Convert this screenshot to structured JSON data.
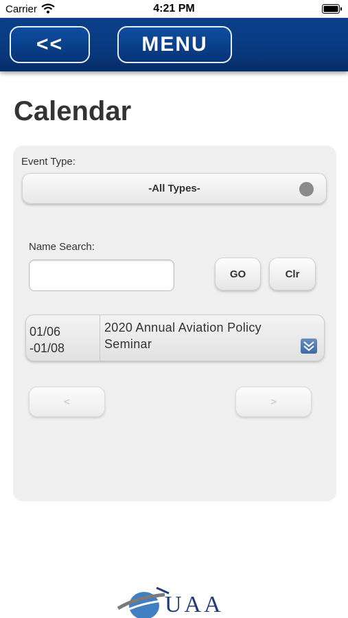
{
  "status_bar": {
    "carrier": "Carrier",
    "time": "4:21 PM"
  },
  "nav": {
    "back_label": "<<",
    "menu_label": "MENU"
  },
  "page": {
    "title": "Calendar"
  },
  "filters": {
    "event_type_label": "Event Type:",
    "event_type_value": "-All Types-",
    "name_search_label": "Name Search:",
    "name_search_value": "",
    "go_label": "GO",
    "clear_label": "Clr"
  },
  "events": [
    {
      "date_start": "01/06",
      "date_end": "-01/08",
      "title": "2020 Annual Aviation Policy Seminar"
    }
  ],
  "pager": {
    "prev_label": "<",
    "next_label": ">"
  },
  "footer": {
    "logo_text": "UAA"
  },
  "colors": {
    "nav_blue": "#0b3f8a",
    "panel_bg": "#efefef",
    "title_text": "#333333"
  }
}
